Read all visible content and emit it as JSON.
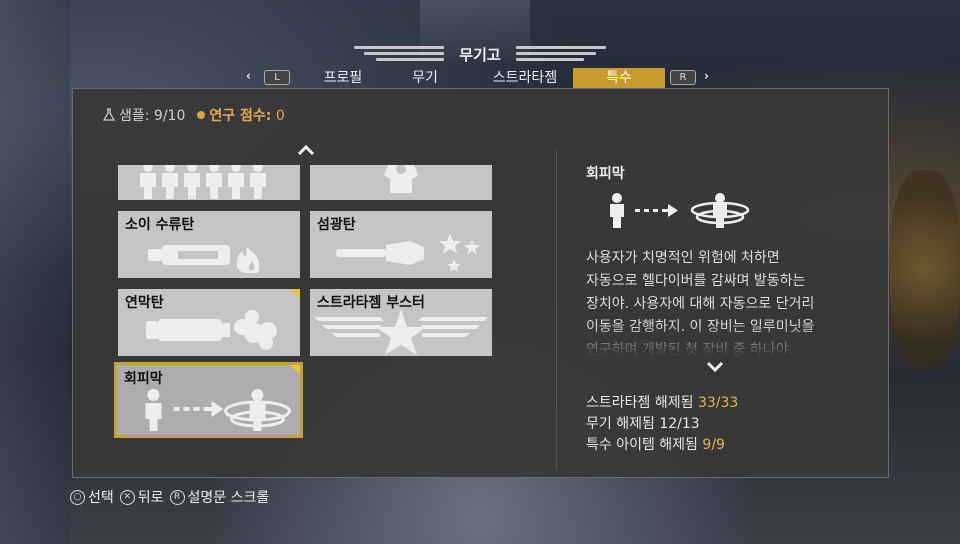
{
  "header": {
    "title": "무기고",
    "tabs": [
      "프로필",
      "무기",
      "스트라타젬",
      "특수"
    ],
    "active_tab": "특수",
    "left_key": "L",
    "right_key": "R",
    "left_chevron": "‹",
    "right_chevron": "›"
  },
  "stats": {
    "samples": "샘플: 9/10",
    "research_label": "연구 점수:",
    "research_value": "0"
  },
  "items": [
    {
      "label": "",
      "icon": "squad-icon"
    },
    {
      "label": "",
      "icon": "armor-icon"
    },
    {
      "label": "소이 수류탄",
      "icon": "incendiary-grenade-icon"
    },
    {
      "label": "섬광탄",
      "icon": "flashbang-icon"
    },
    {
      "label": "연막탄",
      "icon": "smoke-grenade-icon",
      "new": true
    },
    {
      "label": "스트라타젬 부스터",
      "icon": "stratagem-booster-icon"
    },
    {
      "label": "회피막",
      "icon": "evade-icon",
      "new": true,
      "selected": true
    }
  ],
  "detail": {
    "title": "회피막",
    "description_lines": [
      "사용자가 치명적인 위험에 처하면",
      "자동으로 헬다이버를 감싸며 발동하는",
      "장치야. 사용자에 대해 자동으로 단거리",
      "이동을 감행하지. 이 장비는 일루미닛을",
      "연구하며 개발된 첫 장비 중 하나야."
    ]
  },
  "unlocks": [
    {
      "label": "스트라타젬 해제됨",
      "value": "33/33",
      "color": "gold"
    },
    {
      "label": "무기 해제됨",
      "value": "12/13",
      "color": "white"
    },
    {
      "label": "특수 아이템 해제됨",
      "value": "9/9",
      "color": "gold"
    }
  ],
  "footer": [
    {
      "button": "○",
      "label": "선택"
    },
    {
      "button": "✕",
      "label": "뒤로"
    },
    {
      "button": "R",
      "label": "설명문 스크롤"
    }
  ],
  "colors": {
    "accent": "#c89a2e",
    "gold": "#e3b44c",
    "card": "#c5c5c5"
  }
}
